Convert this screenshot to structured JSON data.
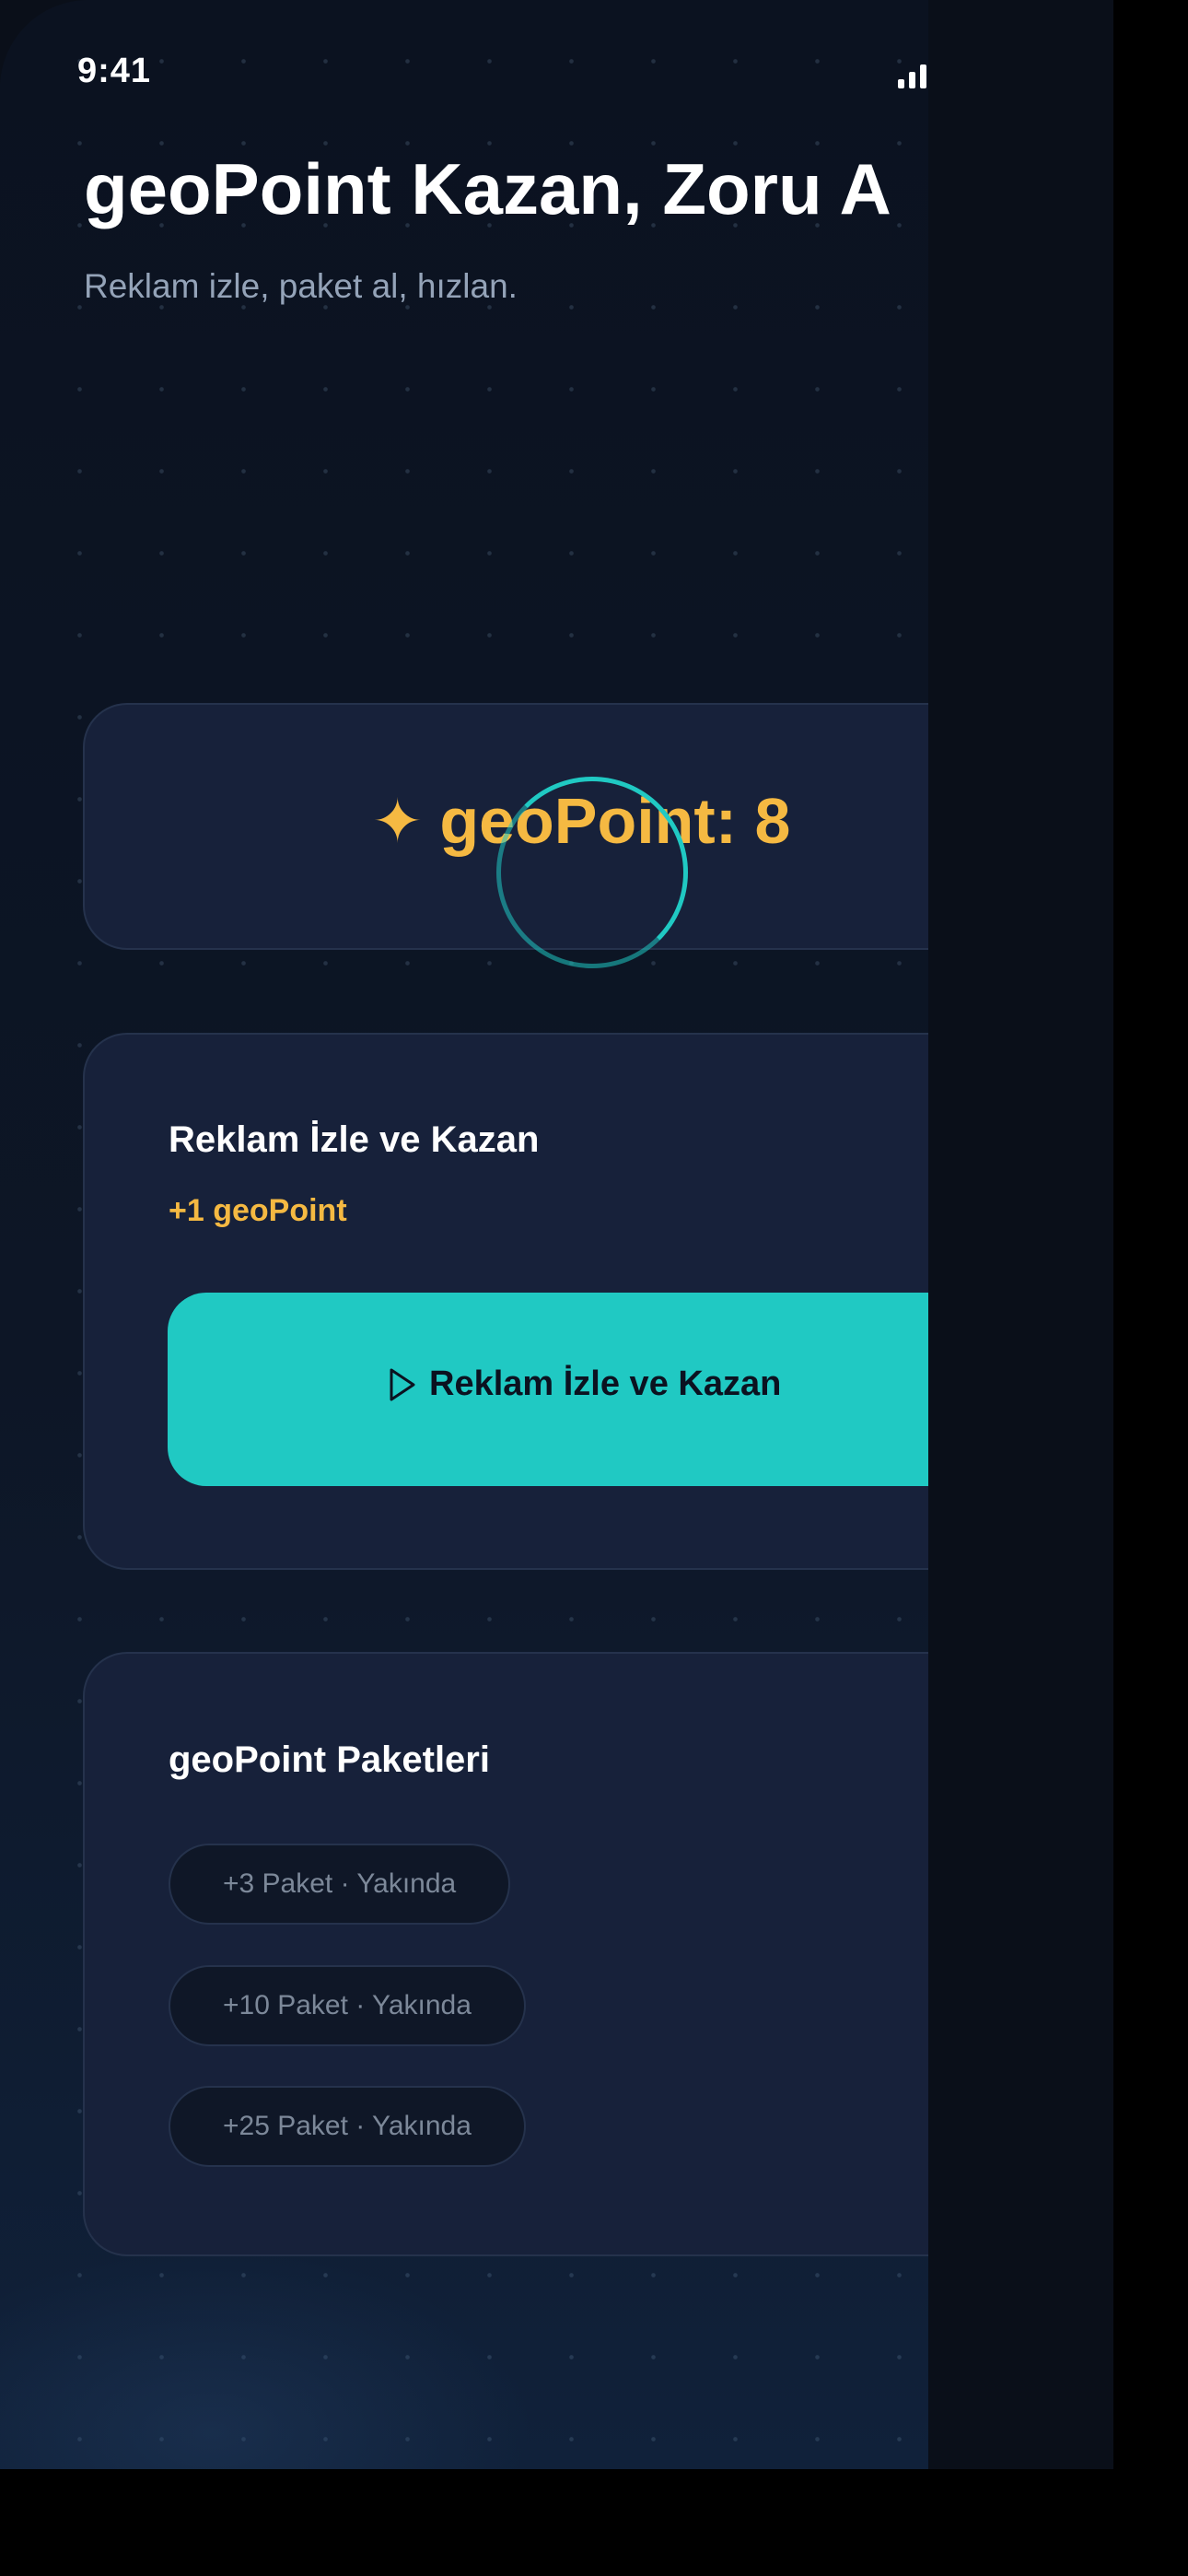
{
  "status_bar": {
    "time": "9:41"
  },
  "header": {
    "title": "geoPoint Kazan, Zoru A",
    "subtitle": "Reklam izle, paket al, hızlan."
  },
  "balance": {
    "icon": "sparkle-icon",
    "star_glyph": "✦",
    "text": "geoPoint: 8",
    "color": "#f5b942"
  },
  "ad_card": {
    "title": "Reklam İzle ve Kazan",
    "reward": "+1 geoPoint",
    "button_label": "Reklam İzle ve Kazan",
    "button_icon": "play-icon",
    "accent": "#20c9c3"
  },
  "packages": {
    "title": "geoPoint Paketleri",
    "items": [
      {
        "label": "+3 Paket · Yakında"
      },
      {
        "label": "+10 Paket · Yakında"
      },
      {
        "label": "+25 Paket · Yakında"
      }
    ]
  }
}
